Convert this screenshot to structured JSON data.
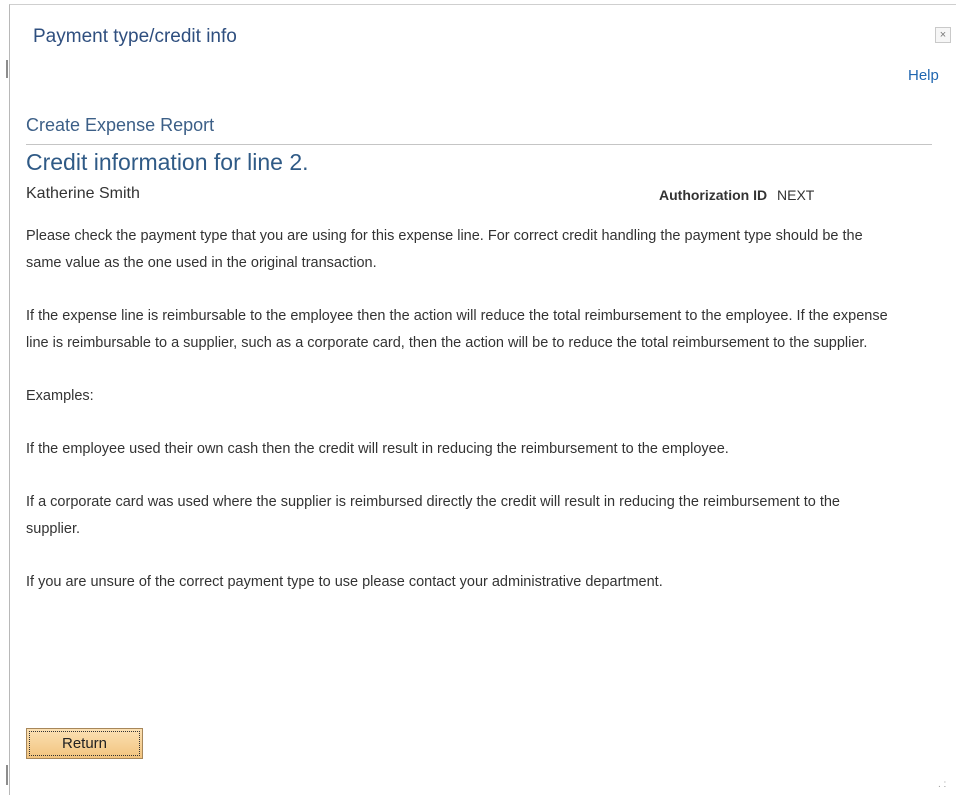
{
  "dialog": {
    "title": "Payment type/credit info",
    "close_label": "×",
    "help_label": "Help"
  },
  "header": {
    "page_subtitle": "Create Expense Report",
    "page_title": "Credit information for line 2.",
    "employee_name": "Katherine Smith",
    "authorization_label": "Authorization ID",
    "authorization_value": "NEXT"
  },
  "body": {
    "paragraphs": [
      "Please check the payment type that you are using for this expense line. For correct credit handling the payment type should be the same value as the one used in the original transaction.",
      "If the expense line is reimbursable to the employee then the action will reduce the total reimbursement to the employee. If the expense line is reimbursable to a supplier, such as a corporate card, then the action will be to reduce the total reimbursement to the supplier.",
      "Examples:",
      "If the employee used their own cash then the credit will result in reducing the reimbursement to the employee.",
      "If a corporate card was used where the supplier is reimbursed directly the credit will result in reducing the reimbursement to the supplier.",
      "If you are unsure of the correct payment type to use please contact your administrative department."
    ]
  },
  "footer": {
    "return_label": "Return"
  },
  "icons": {
    "close": "close-icon",
    "resize": "resize-grip-icon"
  }
}
